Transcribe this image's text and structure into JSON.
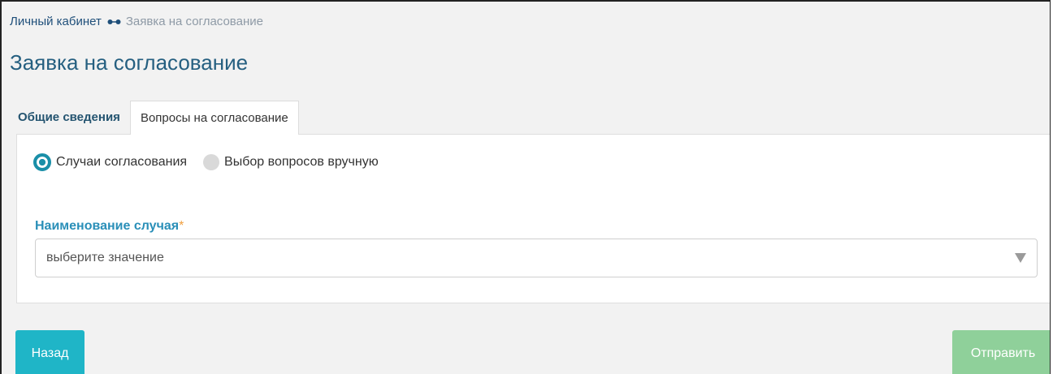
{
  "breadcrumb": {
    "home": "Личный кабинет",
    "current": "Заявка на согласование"
  },
  "page_title": "Заявка на согласование",
  "tabs": [
    {
      "label": "Общие сведения",
      "active": false
    },
    {
      "label": "Вопросы на согласование",
      "active": true
    }
  ],
  "radios": [
    {
      "label": "Случаи согласования",
      "checked": true
    },
    {
      "label": "Выбор вопросов вручную",
      "checked": false
    }
  ],
  "field": {
    "label": "Наименование случая",
    "required_mark": "*",
    "placeholder": "выберите значение"
  },
  "buttons": {
    "back": "Назад",
    "send": "Отправить"
  },
  "colors": {
    "accent": "#1a8fa8",
    "back_button": "#1fb5c7",
    "send_button": "#8fd09a",
    "required": "#f0a040"
  }
}
